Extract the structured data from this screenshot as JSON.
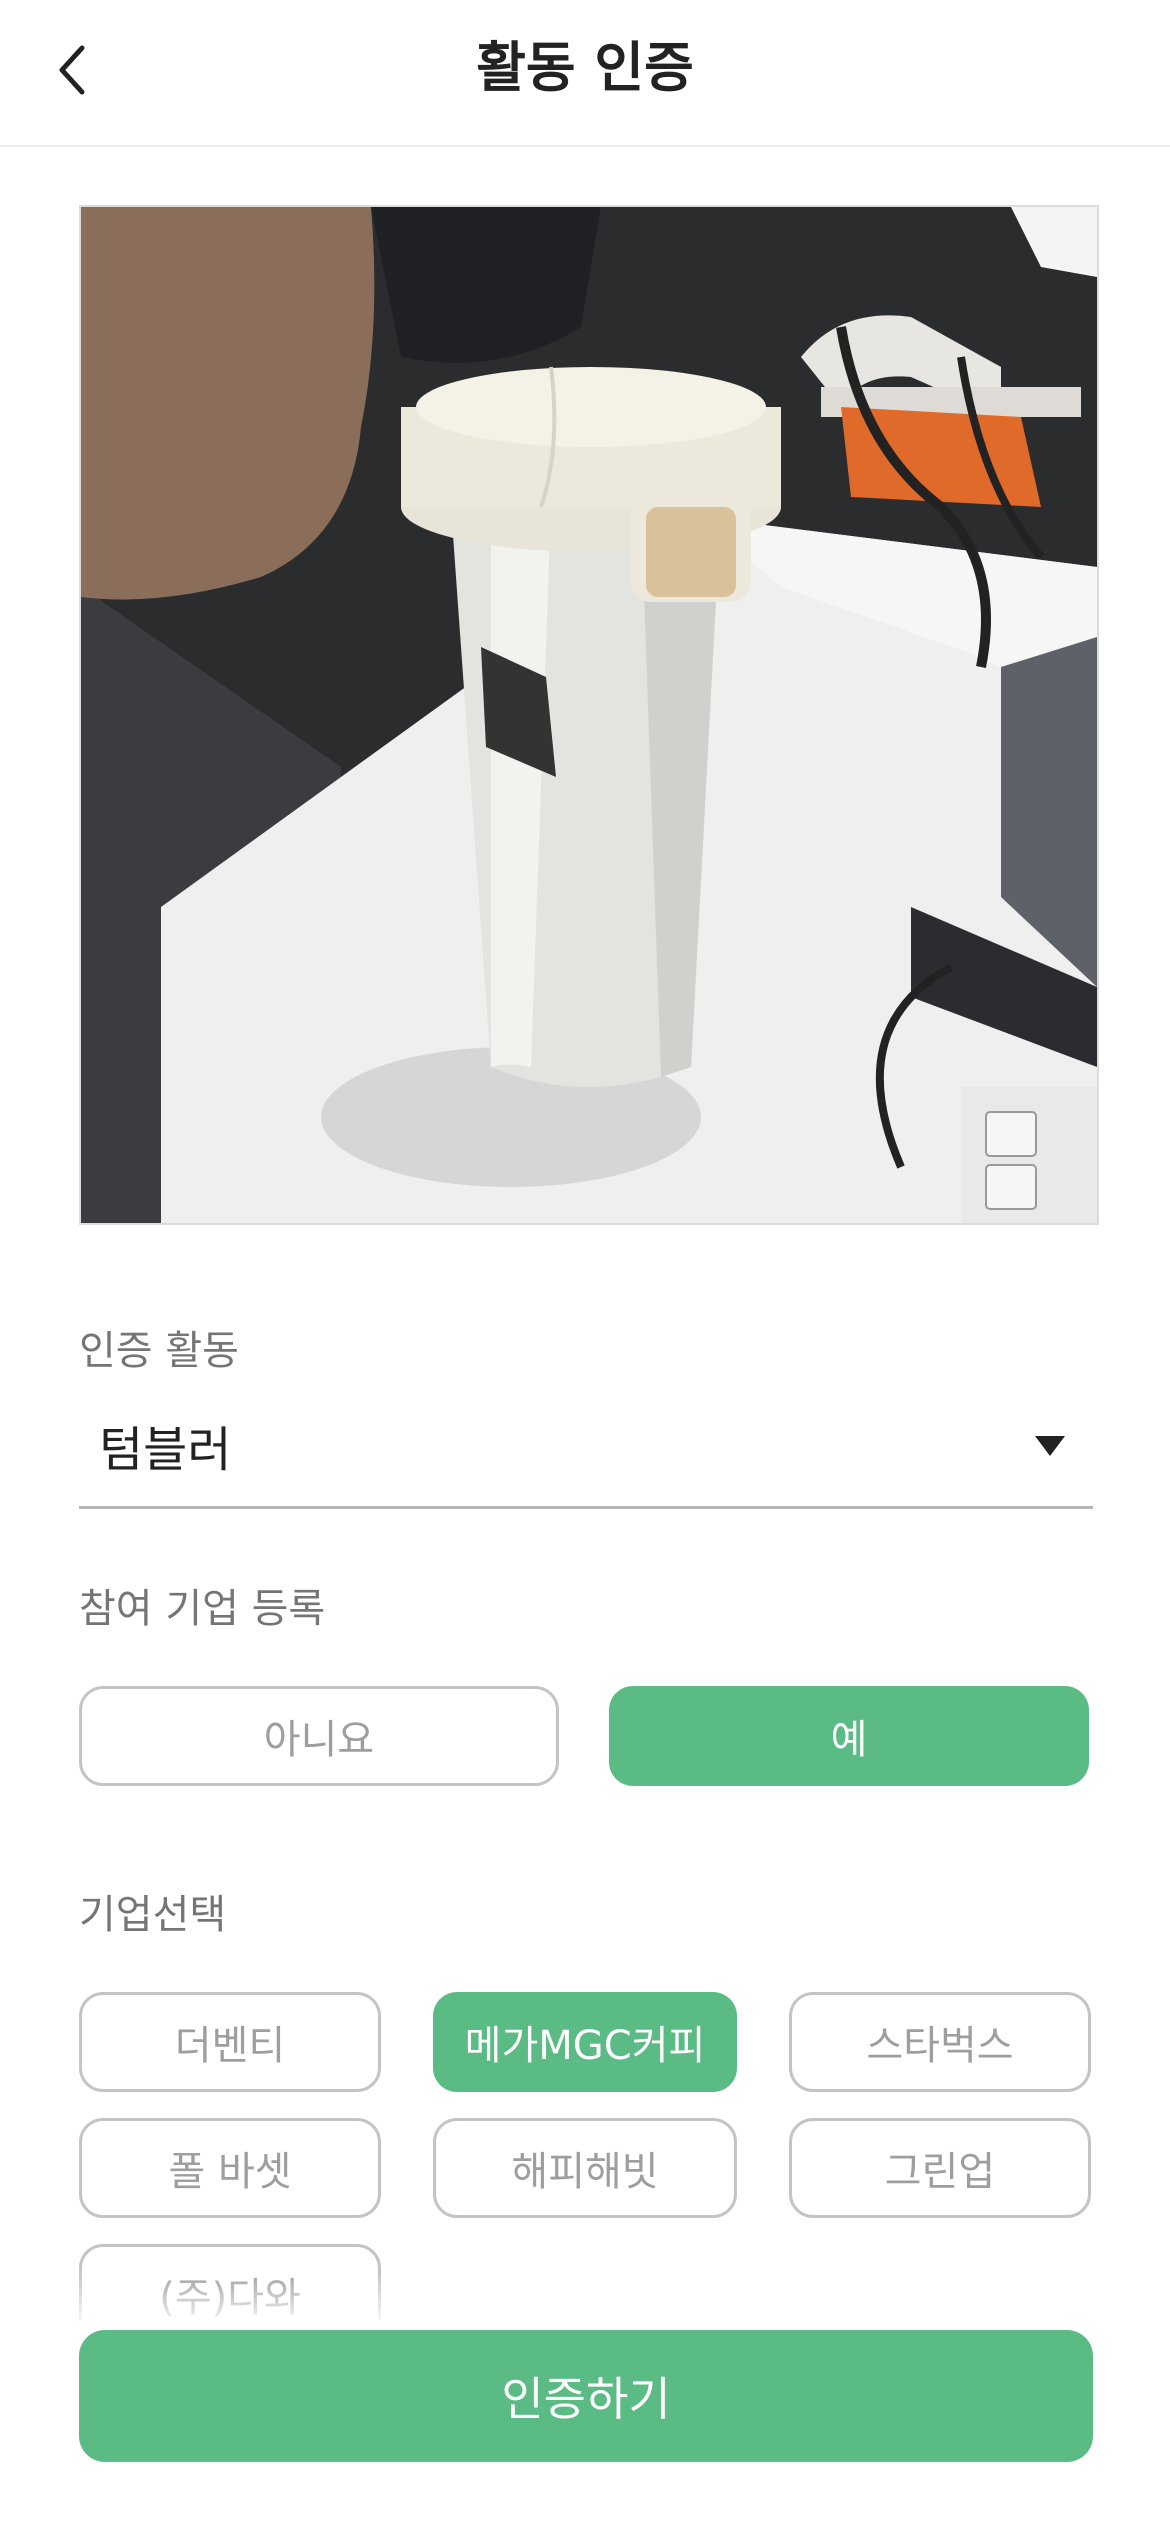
{
  "header": {
    "title": "활동 인증",
    "back_icon": "chevron-left-icon"
  },
  "photo": {
    "subject": "white tumbler on desk"
  },
  "activity": {
    "label": "인증 활동",
    "selected": "텀블러",
    "dropdown_icon": "caret-down-icon"
  },
  "company_registration": {
    "label": "참여 기업 등록",
    "no_label": "아니요",
    "yes_label": "예",
    "selected": "예"
  },
  "company_select": {
    "label": "기업선택",
    "chips": [
      "더벤티",
      "메가MGC커피",
      "스타벅스",
      "폴 바셋",
      "해피해빗",
      "그린업",
      "(주)다와"
    ],
    "selected": "메가MGC커피"
  },
  "submit": {
    "label": "인증하기"
  },
  "colors": {
    "accent": "#5bbb84",
    "border": "#c4c4c4",
    "muted_text": "#9e9e9e",
    "label_text": "#757575"
  }
}
